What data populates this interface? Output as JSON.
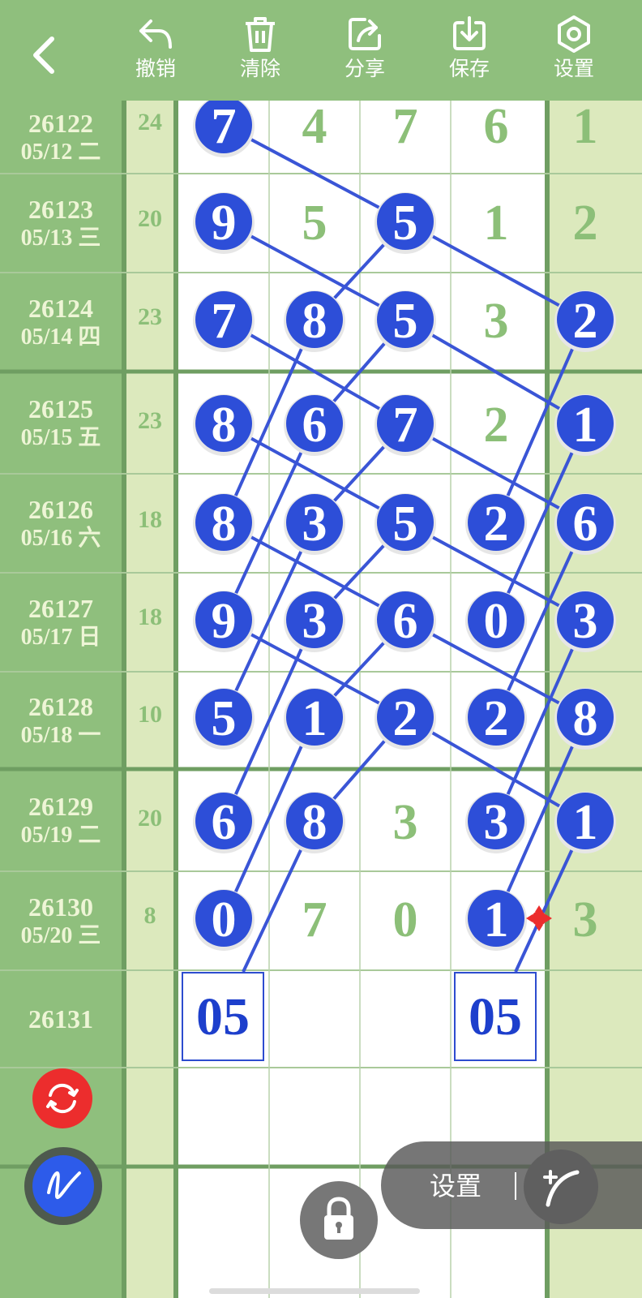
{
  "toolbar": {
    "back_label": "",
    "buttons": [
      {
        "id": "undo",
        "label": "撤销",
        "icon": "undo-icon"
      },
      {
        "id": "clear",
        "label": "清除",
        "icon": "trash-icon"
      },
      {
        "id": "share",
        "label": "分享",
        "icon": "share-icon"
      },
      {
        "id": "save",
        "label": "保存",
        "icon": "download-icon"
      },
      {
        "id": "settings",
        "label": "设置",
        "icon": "gear-icon"
      }
    ]
  },
  "periods": [
    {
      "no": "26122",
      "date": "05/12 二",
      "sum": "24"
    },
    {
      "no": "26123",
      "date": "05/13 三",
      "sum": "20"
    },
    {
      "no": "26124",
      "date": "05/14 四",
      "sum": "23"
    },
    {
      "no": "26125",
      "date": "05/15 五",
      "sum": "23"
    },
    {
      "no": "26126",
      "date": "05/16 六",
      "sum": "18"
    },
    {
      "no": "26127",
      "date": "05/17 日",
      "sum": "18"
    },
    {
      "no": "26128",
      "date": "05/18 一",
      "sum": "10"
    },
    {
      "no": "26129",
      "date": "05/19 二",
      "sum": "20"
    },
    {
      "no": "26130",
      "date": "05/20 三",
      "sum": "8"
    },
    {
      "no": "26131",
      "date": "",
      "sum": ""
    }
  ],
  "grid": {
    "rows": [
      [
        {
          "v": "7",
          "c": 1
        },
        {
          "v": "4",
          "c": 0
        },
        {
          "v": "7",
          "c": 0
        },
        {
          "v": "6",
          "c": 0
        },
        {
          "v": "1",
          "c": 0
        }
      ],
      [
        {
          "v": "9",
          "c": 1
        },
        {
          "v": "5",
          "c": 0
        },
        {
          "v": "5",
          "c": 1
        },
        {
          "v": "1",
          "c": 0
        },
        {
          "v": "2",
          "c": 0
        }
      ],
      [
        {
          "v": "7",
          "c": 1
        },
        {
          "v": "8",
          "c": 1
        },
        {
          "v": "5",
          "c": 1
        },
        {
          "v": "3",
          "c": 0
        },
        {
          "v": "2",
          "c": 1
        }
      ],
      [
        {
          "v": "8",
          "c": 1
        },
        {
          "v": "6",
          "c": 1
        },
        {
          "v": "7",
          "c": 1
        },
        {
          "v": "2",
          "c": 0
        },
        {
          "v": "1",
          "c": 1
        }
      ],
      [
        {
          "v": "8",
          "c": 1
        },
        {
          "v": "3",
          "c": 1
        },
        {
          "v": "5",
          "c": 1
        },
        {
          "v": "2",
          "c": 1
        },
        {
          "v": "6",
          "c": 1
        }
      ],
      [
        {
          "v": "9",
          "c": 1
        },
        {
          "v": "3",
          "c": 1
        },
        {
          "v": "6",
          "c": 1
        },
        {
          "v": "0",
          "c": 1
        },
        {
          "v": "3",
          "c": 1
        }
      ],
      [
        {
          "v": "5",
          "c": 1
        },
        {
          "v": "1",
          "c": 1
        },
        {
          "v": "2",
          "c": 1
        },
        {
          "v": "2",
          "c": 1
        },
        {
          "v": "8",
          "c": 1
        }
      ],
      [
        {
          "v": "6",
          "c": 1
        },
        {
          "v": "8",
          "c": 1
        },
        {
          "v": "3",
          "c": 0
        },
        {
          "v": "3",
          "c": 1
        },
        {
          "v": "1",
          "c": 1
        }
      ],
      [
        {
          "v": "0",
          "c": 1
        },
        {
          "v": "7",
          "c": 0
        },
        {
          "v": "0",
          "c": 0
        },
        {
          "v": "1",
          "c": 1
        },
        {
          "v": "3",
          "c": 0
        }
      ]
    ],
    "predictions": [
      {
        "col": 0,
        "value": "05"
      },
      {
        "col": 3,
        "value": "05"
      }
    ]
  },
  "float_bar": {
    "label": "设置",
    "icon": "curve-tool-icon"
  },
  "lock_icon": "lock-icon",
  "refresh_icon": "refresh-icon",
  "pen_icon": "pen-icon",
  "colors": {
    "green": "#8fbf7d",
    "light_green": "#dce9bd",
    "ball": "#2d4ed8",
    "line": "#3a55d6",
    "plain_num": "#8cbf78",
    "red": "#ec2d2d"
  }
}
